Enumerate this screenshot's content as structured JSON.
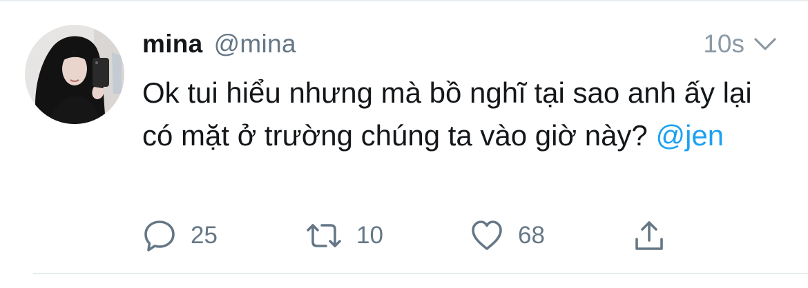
{
  "tweet": {
    "display_name": "mina",
    "handle": "@mina",
    "time": "10s",
    "text_main": "Ok tui hiểu nhưng mà bồ nghĩ tại sao anh ấy lại có mặt ở trường chúng ta vào giờ này? ",
    "mention": "@jen",
    "avatar_icon": "profile-photo",
    "menu_icon": "chevron-down-icon"
  },
  "actions": {
    "reply": {
      "icon": "reply-icon",
      "count": "25"
    },
    "retweet": {
      "icon": "retweet-icon",
      "count": "10"
    },
    "like": {
      "icon": "heart-icon",
      "count": "68"
    },
    "share": {
      "icon": "share-icon"
    }
  },
  "colors": {
    "text": "#14171a",
    "secondary": "#657786",
    "mention": "#1da1f2",
    "divider": "#e6ecf0"
  }
}
